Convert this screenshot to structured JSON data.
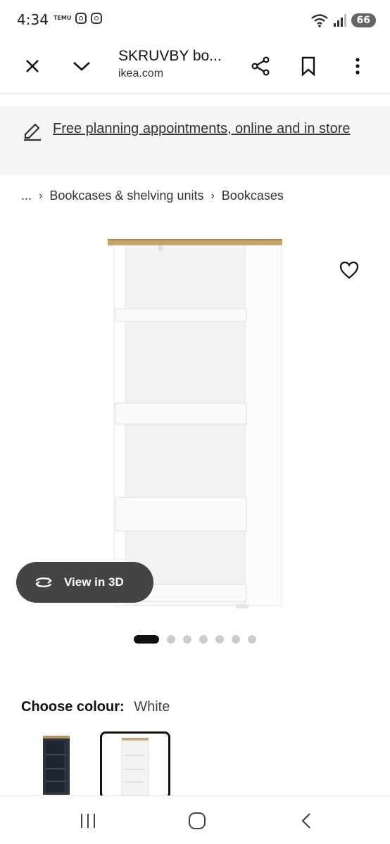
{
  "status_bar": {
    "time": "4:34",
    "temu_label": "TEMU",
    "battery": "66"
  },
  "browser": {
    "title": "SKRUVBY bo...",
    "domain": "ikea.com"
  },
  "banner": {
    "text": "Free planning appointments, online and in store"
  },
  "breadcrumb": {
    "ellipsis": "...",
    "items": [
      "Bookcases & shelving units",
      "Bookcases"
    ]
  },
  "product": {
    "view3d_label": "View in 3D",
    "carousel": {
      "total": 7,
      "active": 1
    }
  },
  "colour": {
    "label": "Choose colour:",
    "value": "White"
  },
  "swatches": [
    {
      "name": "black-blue",
      "selected": false
    },
    {
      "name": "white",
      "selected": true
    }
  ]
}
